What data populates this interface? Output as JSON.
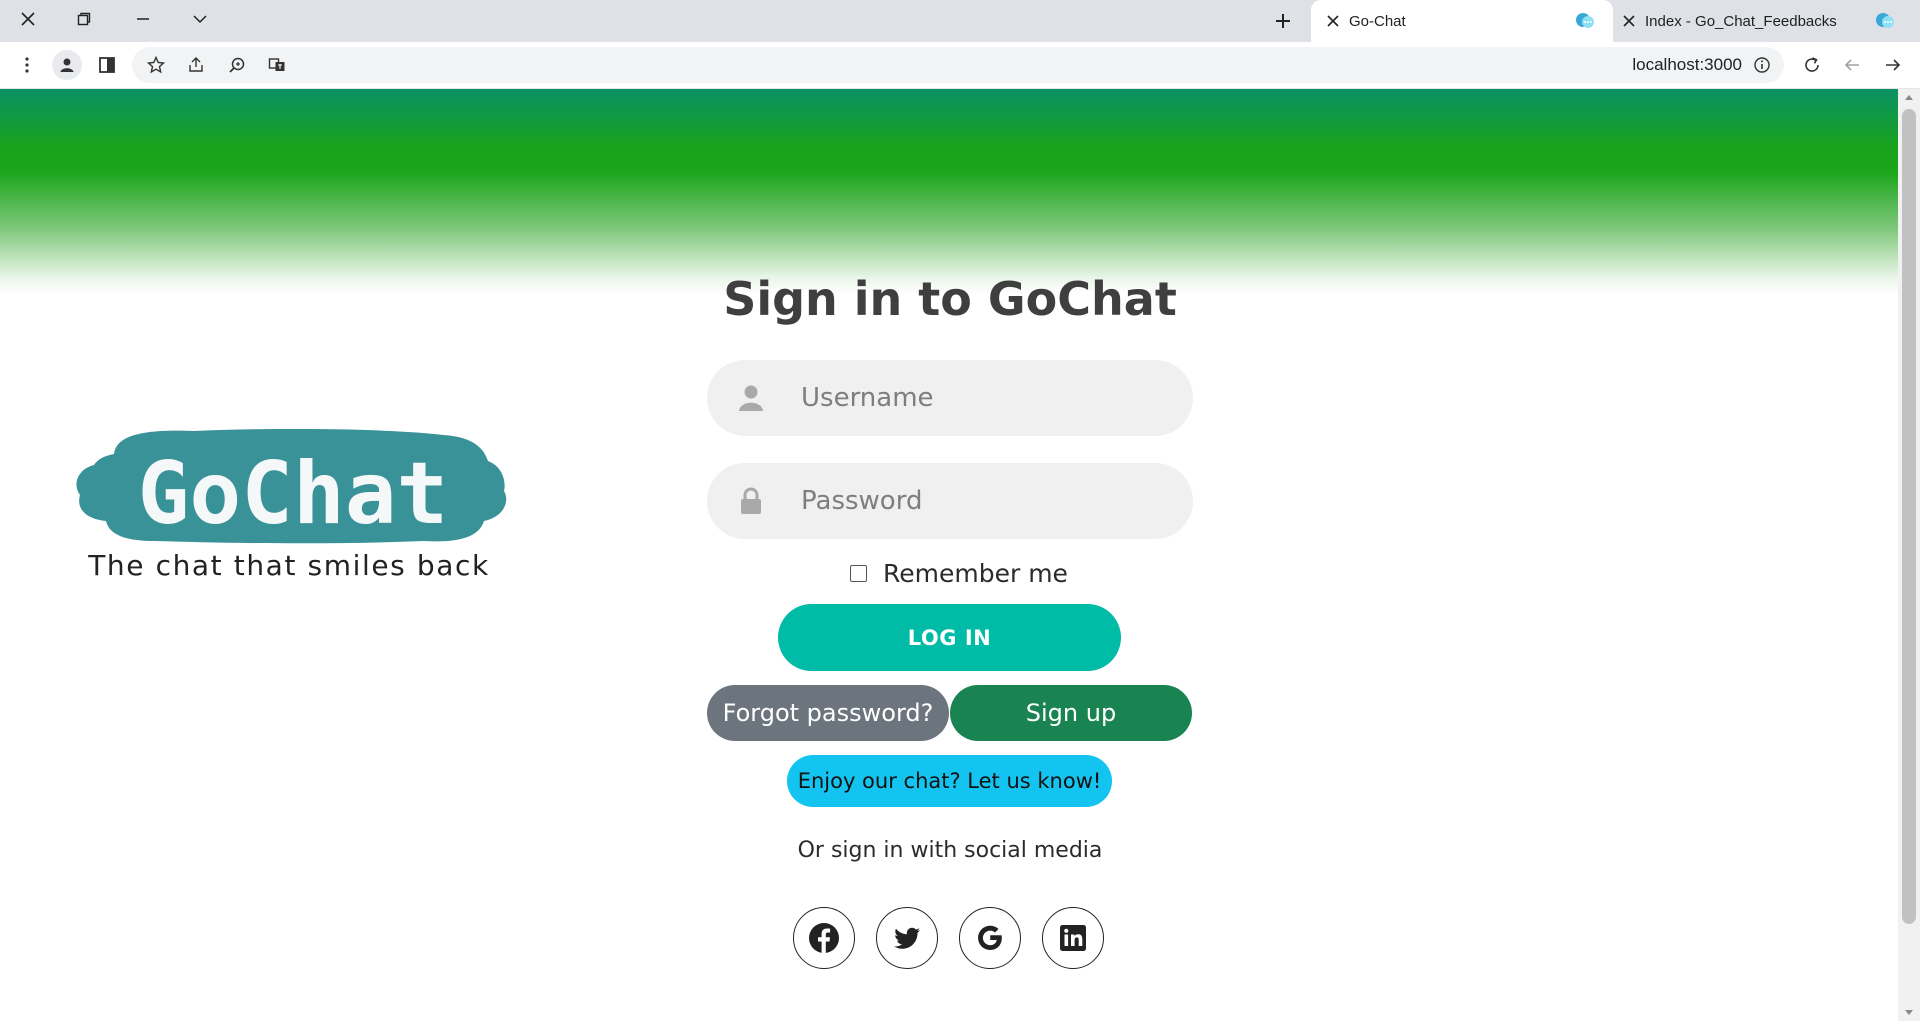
{
  "browser": {
    "tabs": [
      {
        "title": "Go-Chat",
        "active": true
      },
      {
        "title": "Index - Go_Chat_Feedbacks",
        "active": false
      }
    ],
    "url": "localhost:3000"
  },
  "logo": {
    "brand": "GoChat",
    "tagline": "The chat that smiles back"
  },
  "login": {
    "heading": "Sign in to GoChat",
    "username_placeholder": "Username",
    "password_placeholder": "Password",
    "remember_label": "Remember me",
    "login_button": "LOG IN",
    "forgot_button": "Forgot password?",
    "signup_button": "Sign up",
    "feedback_button": "Enjoy our chat? Let us know!",
    "social_text": "Or sign in with social media",
    "social": [
      "facebook-icon",
      "twitter-icon",
      "google-icon",
      "linkedin-icon"
    ]
  },
  "colors": {
    "login": "#00bba6",
    "forgot": "#6c757d",
    "signup": "#198452",
    "feedback": "#14c4f0",
    "logo_teal": "#3a9299",
    "banner_green": "#1aa51a"
  }
}
